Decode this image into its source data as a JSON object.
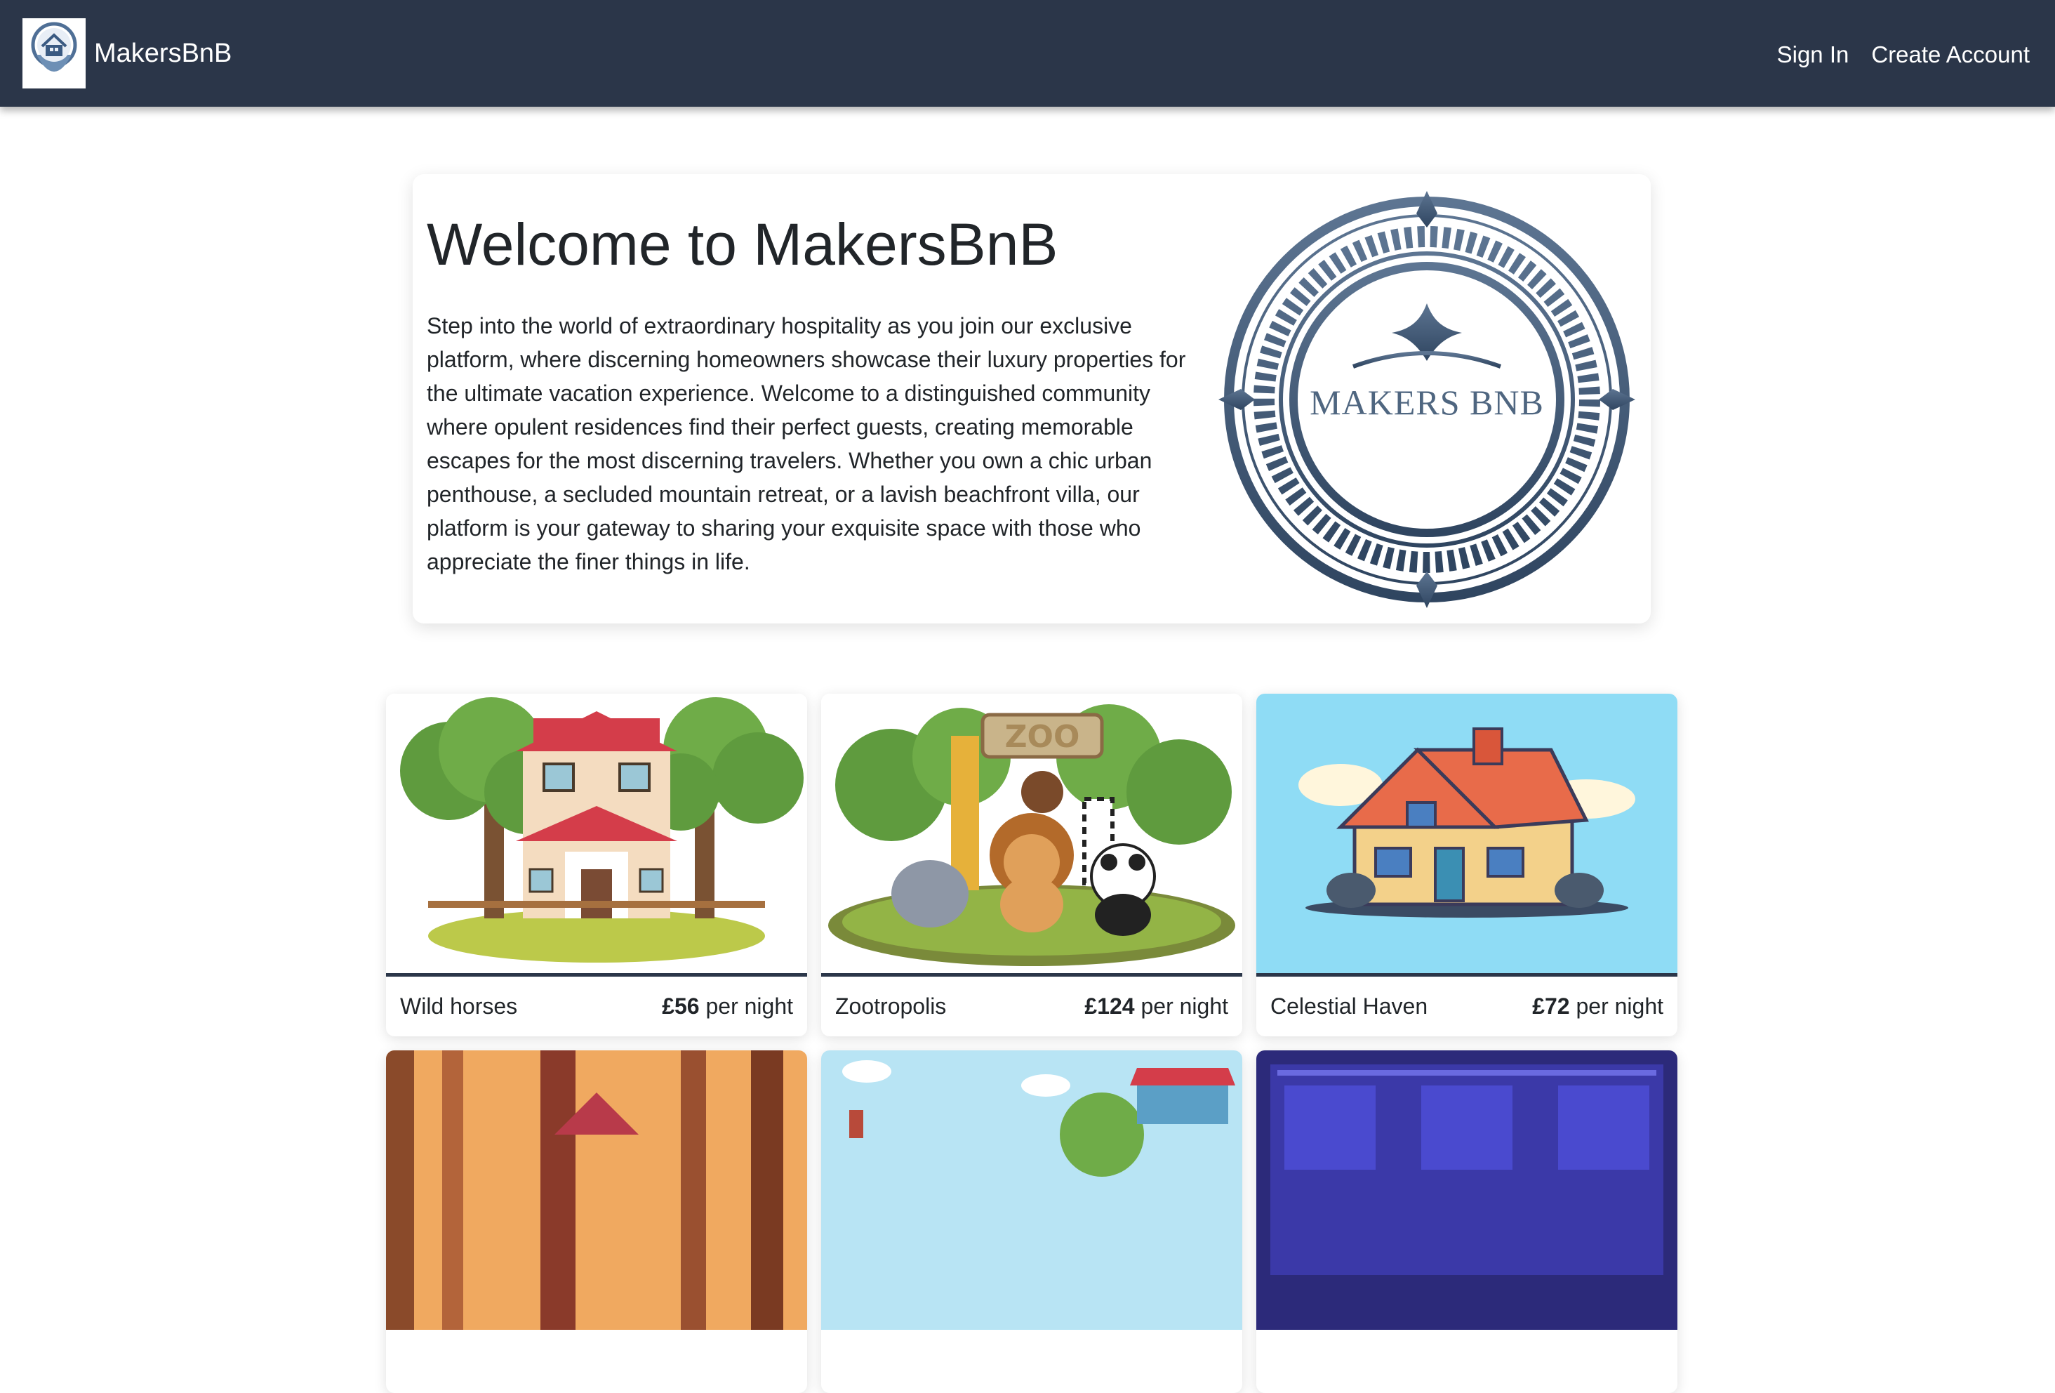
{
  "navbar": {
    "brand_name": "MakersBnB",
    "logo_icon": "location-pin-house-icon",
    "links": [
      "Sign In",
      "Create Account"
    ]
  },
  "hero": {
    "title": "Welcome to MakersBnB",
    "text": "Step into the world of extraordinary hospitality as you join our exclusive platform, where discerning homeowners showcase their luxury properties for the ultimate vacation experience. Welcome to a distinguished community where opulent residences find their perfect guests, creating memorable escapes for the most discerning travelers. Whether you own a chic urban penthouse, a secluded mountain retreat, or a lavish beachfront villa, our platform is your gateway to sharing your exquisite space with those who appreciate the finer things in life.",
    "emblem_text": "Makers BnB"
  },
  "listings": [
    {
      "name": "Wild horses",
      "price": "£56",
      "unit": "per night",
      "image": "cartoon-house-with-trees"
    },
    {
      "name": "Zootropolis",
      "price": "£124",
      "unit": "per night",
      "image": "cartoon-zoo-animals"
    },
    {
      "name": "Celestial Haven",
      "price": "£72",
      "unit": "per night",
      "image": "cartoon-house-blue-sky"
    }
  ],
  "partial_listings": [
    {
      "image": "forest-cabin"
    },
    {
      "image": "village-houses"
    },
    {
      "image": "modern-building-night"
    }
  ],
  "colors": {
    "navbar_bg": "#2b3649",
    "accent": "#2b3649",
    "emblem": "#4f6680"
  }
}
